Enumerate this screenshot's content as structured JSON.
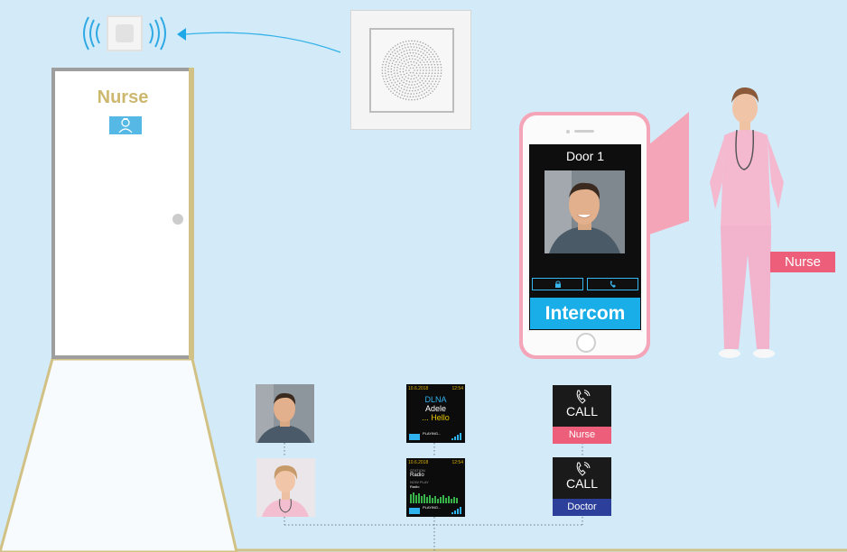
{
  "scene": {
    "door_label": "Nurse",
    "phone": {
      "door_title": "Door 1",
      "app_banner": "Intercom"
    },
    "nurse_tag": "Nurse"
  },
  "panels": {
    "player_1": {
      "date": "10.6.2018",
      "time": "12:54",
      "source": "DLNA",
      "artist": "Adele",
      "track": "... Hello",
      "status": "PLAYING..."
    },
    "player_2": {
      "date": "10.6.2018",
      "time": "12:54",
      "station_label": "STATION",
      "station": "Radio",
      "now_label": "NOW PLAY",
      "now": "Radio",
      "status": "PLAYING..."
    },
    "call_1": {
      "label": "CALL",
      "who": "Nurse"
    },
    "call_2": {
      "label": "CALL",
      "who": "Doctor"
    }
  },
  "colors": {
    "background": "#d3ebf9",
    "accent_blue": "#19aee8",
    "nurse_pink": "#ec5e79",
    "doctor_blue": "#2b3f9b",
    "door_gold": "#cdb870"
  },
  "icons": [
    "lock-icon",
    "phone-icon",
    "nurse-icon",
    "sound-wave-icon",
    "arrow-icon"
  ]
}
